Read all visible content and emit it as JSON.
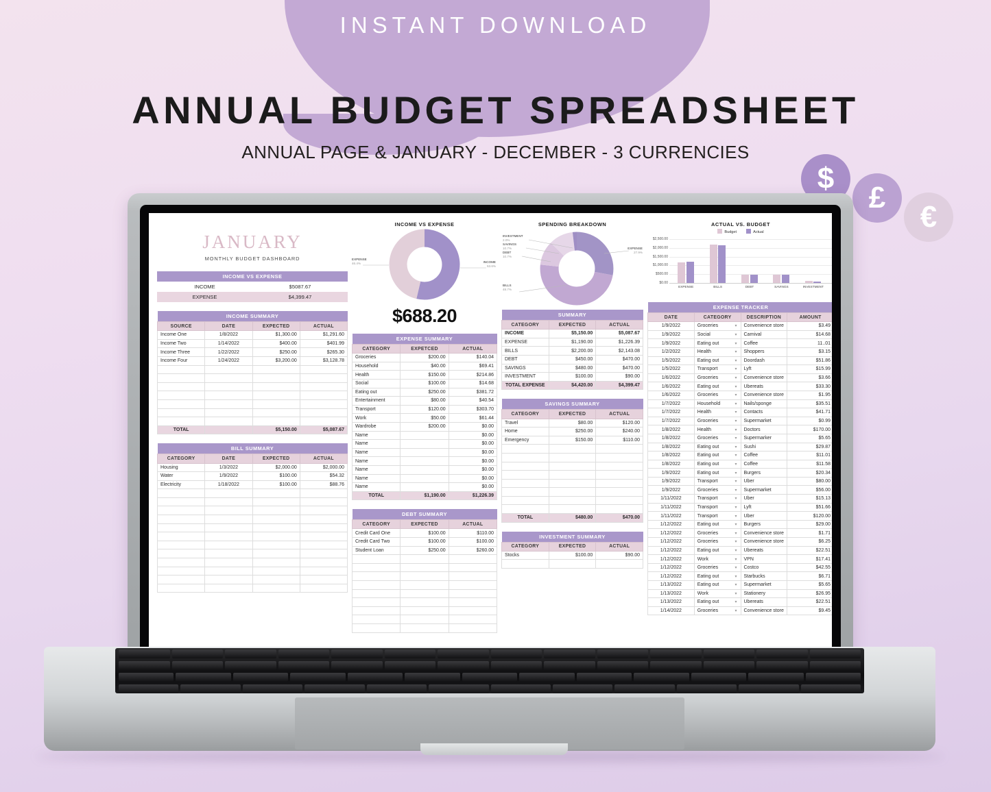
{
  "promo": {
    "badge": "INSTANT DOWNLOAD",
    "title": "ANNUAL BUDGET SPREADSHEET",
    "subtitle": "ANNUAL PAGE & JANUARY - DECEMBER - 3 CURRENCIES",
    "currencies": [
      {
        "name": "dollar-icon",
        "glyph": "$",
        "color": "#a98fc9"
      },
      {
        "name": "pound-icon",
        "glyph": "£",
        "color": "#bba2d2"
      },
      {
        "name": "euro-icon",
        "glyph": "€",
        "color": "#e0cfdf"
      }
    ]
  },
  "colors": {
    "header_purple": "#a997ca",
    "header_pink": "#e6d2dc",
    "total_pink": "#e9d6e0",
    "bar_budget": "#dfc7d5",
    "bar_actual": "#a191c9",
    "title_pink": "#d9b9c6"
  },
  "sheet": {
    "month": "JANUARY",
    "subtitle": "MONTHLY BUDGET DASHBOARD",
    "income_vs_expense": {
      "title": "INCOME VS EXPENSE",
      "rows": [
        {
          "label": "INCOME",
          "value": "$5087.67"
        },
        {
          "label": "EXPENSE",
          "value": "$4,399.47"
        }
      ]
    },
    "income_summary": {
      "title": "INCOME SUMMARY",
      "headers": [
        "SOURCE",
        "DATE",
        "EXPECTED",
        "ACTUAL"
      ],
      "rows": [
        [
          "Income One",
          "1/8/2022",
          "$1,300.00",
          "$1,291.60"
        ],
        [
          "Income Two",
          "1/14/2022",
          "$400.00",
          "$401.99"
        ],
        [
          "Income Three",
          "1/22/2022",
          "$250.00",
          "$265.30"
        ],
        [
          "Income Four",
          "1/24/2022",
          "$3,200.00",
          "$3,128.78"
        ]
      ],
      "blank_rows": 7,
      "total": [
        "TOTAL",
        "",
        "$5,150.00",
        "$5,087.67"
      ]
    },
    "bill_summary": {
      "title": "BILL SUMMARY",
      "headers": [
        "CATEGORY",
        "DATE",
        "EXPECTED",
        "ACTUAL"
      ],
      "rows": [
        [
          "Housing",
          "1/3/2022",
          "$2,000.00",
          "$2,000.00"
        ],
        [
          "Water",
          "1/9/2022",
          "$100.00",
          "$54.32"
        ],
        [
          "Electricity",
          "1/18/2022",
          "$100.00",
          "$88.76"
        ]
      ],
      "blank_rows": 12
    },
    "expense_summary": {
      "title": "EXPENSE SUMMARY",
      "headers": [
        "CATEGORY",
        "EXPETCED",
        "ACTUAL"
      ],
      "rows": [
        [
          "Groceries",
          "$200.00",
          "$140.04"
        ],
        [
          "Household",
          "$40.00",
          "$69.41"
        ],
        [
          "Health",
          "$150.00",
          "$214.86"
        ],
        [
          "Social",
          "$100.00",
          "$14.68"
        ],
        [
          "Eating out",
          "$250.00",
          "$381.72"
        ],
        [
          "Entertainment",
          "$80.00",
          "$40.54"
        ],
        [
          "Transport",
          "$120.00",
          "$303.70"
        ],
        [
          "Work",
          "$50.00",
          "$61.44"
        ],
        [
          "Wardrobe",
          "$200.00",
          "$0.00"
        ],
        [
          "Name",
          "",
          "$0.00"
        ],
        [
          "Name",
          "",
          "$0.00"
        ],
        [
          "Name",
          "",
          "$0.00"
        ],
        [
          "Name",
          "",
          "$0.00"
        ],
        [
          "Name",
          "",
          "$0.00"
        ],
        [
          "Name",
          "",
          "$0.00"
        ],
        [
          "Name",
          "",
          "$0.00"
        ]
      ],
      "total": [
        "TOTAL",
        "$1,190.00",
        "$1,226.39"
      ]
    },
    "debt_summary": {
      "title": "DEBT SUMMARY",
      "headers": [
        "CATEGORY",
        "EXPECTED",
        "ACTUAL"
      ],
      "rows": [
        [
          "Credit Card One",
          "$100.00",
          "$110.00"
        ],
        [
          "Credit Card Two",
          "$100.00",
          "$100.00"
        ],
        [
          "Student Loan",
          "$250.00",
          "$260.00"
        ]
      ],
      "blank_rows": 9
    },
    "summary": {
      "title": "SUMMARY",
      "headers": [
        "CATEGORY",
        "EXPECTED",
        "ACTUAL"
      ],
      "rows": [
        [
          "INCOME",
          "$5,150.00",
          "$5,087.67"
        ],
        [
          "EXPENSE",
          "$1,190.00",
          "$1,226.39"
        ],
        [
          "BILLS",
          "$2,200.00",
          "$2,143.08"
        ],
        [
          "DEBT",
          "$450.00",
          "$470.00"
        ],
        [
          "SAVINGS",
          "$480.00",
          "$470.00"
        ],
        [
          "INVESTMENT",
          "$100.00",
          "$90.00"
        ]
      ],
      "total": [
        "TOTAL EXPENSE",
        "$4,420.00",
        "$4,399.47"
      ]
    },
    "savings_summary": {
      "title": "SAVINGS SUMMARY",
      "headers": [
        "CATEGORY",
        "EXPECTED",
        "ACTUAL"
      ],
      "rows": [
        [
          "Travel",
          "$80.00",
          "$120.00"
        ],
        [
          "Home",
          "$250.00",
          "$240.00"
        ],
        [
          "Emergency",
          "$150.00",
          "$110.00"
        ]
      ],
      "blank_rows": 8,
      "total": [
        "TOTAL",
        "$480.00",
        "$470.00"
      ]
    },
    "investment_summary": {
      "title": "INVESTMENT SUMMARY",
      "headers": [
        "CATEGORY",
        "EXPECTED",
        "ACTUAL"
      ],
      "rows": [
        [
          "Stocks",
          "$100.00",
          "$90.00"
        ]
      ],
      "blank_rows": 1
    },
    "expense_tracker": {
      "title": "EXPENSE TRACKER",
      "headers": [
        "DATE",
        "CATEGORY",
        "DESCRIPTION",
        "AMOUNT"
      ],
      "rows": [
        [
          "1/9/2022",
          "Groceries",
          "Convenience store",
          "$3.49"
        ],
        [
          "1/9/2022",
          "Social",
          "Carnival",
          "$14.68"
        ],
        [
          "1/9/2022",
          "Eating out",
          "Coffee",
          "11..01"
        ],
        [
          "1/2/2022",
          "Health",
          "Shoppers",
          "$3.15"
        ],
        [
          "1/5/2022",
          "Eating out",
          "Doordash",
          "$51.86"
        ],
        [
          "1/5/2022",
          "Transport",
          "Lyft",
          "$15.99"
        ],
        [
          "1/6/2022",
          "Groceries",
          "Convenience store",
          "$3.66"
        ],
        [
          "1/6/2022",
          "Eating out",
          "Ubereats",
          "$33.30"
        ],
        [
          "1/6/2022",
          "Groceries",
          "Convenience store",
          "$1.95"
        ],
        [
          "1/7/2022",
          "Household",
          "Nails/sponge",
          "$35.51"
        ],
        [
          "1/7/2022",
          "Health",
          "Contacts",
          "$41.71"
        ],
        [
          "1/7/2022",
          "Groceries",
          "Supermarket",
          "$0.99"
        ],
        [
          "1/8/2022",
          "Health",
          "Doctors",
          "$170.00"
        ],
        [
          "1/8/2022",
          "Groceries",
          "Supermarker",
          "$5.65"
        ],
        [
          "1/8/2022",
          "Eating out",
          "Sushi",
          "$29.87"
        ],
        [
          "1/8/2022",
          "Eating out",
          "Coffee",
          "$11.01"
        ],
        [
          "1/8/2022",
          "Eating out",
          "Coffee",
          "$11.58"
        ],
        [
          "1/9/2022",
          "Eating out",
          "Burgers",
          "$20.34"
        ],
        [
          "1/9/2022",
          "Transport",
          "Uber",
          "$80.00"
        ],
        [
          "1/9/2022",
          "Groceries",
          "Supermarket",
          "$56.00"
        ],
        [
          "1/11/2022",
          "Transport",
          "Uber",
          "$15.13"
        ],
        [
          "1/11/2022",
          "Transport",
          "Lyft",
          "$51.66"
        ],
        [
          "1/11/2022",
          "Transport",
          "Uber",
          "$120.00"
        ],
        [
          "1/12/2022",
          "Eating out",
          "Burgers",
          "$29.00"
        ],
        [
          "1/12/2022",
          "Groceries",
          "Convenience store",
          "$1.71"
        ],
        [
          "1/12/2022",
          "Groceries",
          "Convenience store",
          "$6.25"
        ],
        [
          "1/12/2022",
          "Eating out",
          "Ubereats",
          "$22.51"
        ],
        [
          "1/12/2022",
          "Work",
          "VPN",
          "$17.41"
        ],
        [
          "1/12/2022",
          "Groceries",
          "Costco",
          "$42.55"
        ],
        [
          "1/12/2022",
          "Eating out",
          "Starbucks",
          "$6.71"
        ],
        [
          "1/13/2022",
          "Eating out",
          "Supermarket",
          "$5.65"
        ],
        [
          "1/13/2022",
          "Work",
          "Stationery",
          "$26.95"
        ],
        [
          "1/13/2022",
          "Eating out",
          "Ubereats",
          "$22.51"
        ],
        [
          "1/14/2022",
          "Groceries",
          "Convenience store",
          "$9.45"
        ]
      ]
    }
  },
  "chart_data": [
    {
      "type": "pie",
      "name": "income-vs-expense-donut",
      "title": "INCOME VS EXPENSE",
      "labels": [
        "INCOME",
        "EXPENSE"
      ],
      "values": [
        53.6,
        46.4
      ],
      "value_labels": [
        "53.6%",
        "46.4%"
      ],
      "colors": [
        "#a191c9",
        "#e2cfd9"
      ],
      "center_caption": "$688.20",
      "legend": "callouts"
    },
    {
      "type": "pie",
      "name": "spending-breakdown-donut",
      "title": "SPENDING BREAKDOWN",
      "labels": [
        "EXPENSE",
        "BILLS",
        "DEBT",
        "SAVINGS",
        "INVESTMENT"
      ],
      "values": [
        27.9,
        48.7,
        10.7,
        10.7,
        2.0
      ],
      "value_labels": [
        "27.9%",
        "48.7%",
        "10.7%",
        "10.7%",
        "2.0%"
      ],
      "colors": [
        "#a294c6",
        "#c1a8d2",
        "#dcc8e0",
        "#e6d7e8",
        "#9f8ec4"
      ],
      "legend": "callouts"
    },
    {
      "type": "bar",
      "name": "actual-vs-budget-bars",
      "title": "ACTUAL VS. BUDGET",
      "categories": [
        "EXPENSE",
        "BILLS",
        "DEBT",
        "SAVINGS",
        "INVESTMENT"
      ],
      "series": [
        {
          "name": "Budget",
          "values": [
            1190.0,
            2200.0,
            450.0,
            480.0,
            100.0
          ],
          "color": "#dfc7d5"
        },
        {
          "name": "Actual",
          "values": [
            1226.39,
            2143.08,
            470.0,
            470.0,
            90.0
          ],
          "color": "#a191c9"
        }
      ],
      "ylim": [
        0,
        2500
      ],
      "yticks": [
        "$0.00",
        "$500.00",
        "$1,000.00",
        "$1,500.00",
        "$2,000.00",
        "$2,500.00"
      ],
      "xlabel": "",
      "ylabel": "",
      "grid": true,
      "legend_position": "top"
    }
  ]
}
